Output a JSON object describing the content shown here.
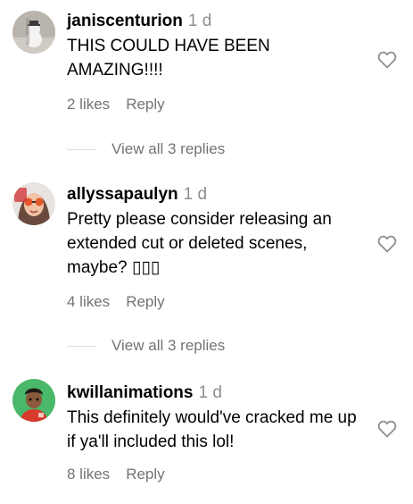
{
  "comments": [
    {
      "username": "janiscenturion",
      "age": "1 d",
      "text": "THIS COULD HAVE BEEN AMAZING!!!!",
      "likes": "2 likes",
      "reply": "Reply",
      "view_replies": "View all 3 replies",
      "avatar_icon": "avatar-snowman-photo"
    },
    {
      "username": "allyssapaulyn",
      "age": "1 d",
      "text": "Pretty please consider releasing an extended cut or deleted scenes, maybe? ▯▯▯",
      "likes": "4 likes",
      "reply": "Reply",
      "view_replies": "View all 3 replies",
      "avatar_icon": "avatar-sunglasses-photo"
    },
    {
      "username": "kwillanimations",
      "age": "1 d",
      "text": "This definitely would've cracked me up if ya'll included this lol!",
      "likes": "8 likes",
      "reply": "Reply",
      "avatar_icon": "avatar-cartoon-character"
    }
  ],
  "colors": {
    "username": "#000000",
    "secondary": "#737373",
    "divider": "#dbdbdb",
    "heart_outline": "#8e8e8e"
  }
}
